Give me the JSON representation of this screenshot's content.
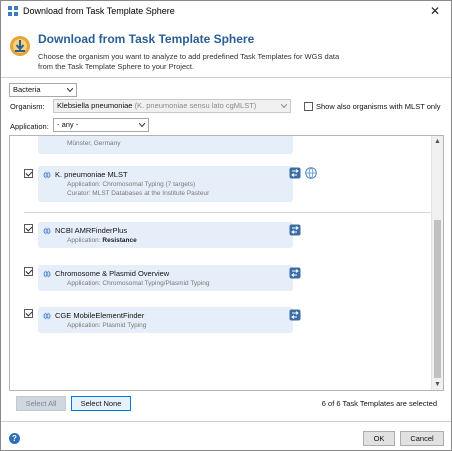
{
  "window": {
    "title": "Download from Task Template Sphere",
    "close_glyph": "✕"
  },
  "header": {
    "title": "Download from Task Template Sphere",
    "description_line1": "Choose the organism you want to analyze to add predefined Task Templates for WGS data",
    "description_line2": "from the Task Template Sphere to your Project."
  },
  "filters": {
    "domain_value": "Bacteria",
    "organism_label": "Organism:",
    "organism_value": "Klebsiella pneumoniae",
    "organism_extra": "(K. pneumoniae sensu lato cgMLST)",
    "show_mlst_label": "Show also organisms with MLST only",
    "show_mlst_checked": false,
    "application_label": "Application:",
    "application_value": "- any -"
  },
  "templates": [
    {
      "name": "",
      "sub1": "Münster, Germany",
      "sub2": "",
      "checked": true
    },
    {
      "name": "K. pneumoniae MLST",
      "sub1": "Application: Chromosomal Typing (7 targets)",
      "sub2": "Curator: MLST Databases at the Institute Pasteur",
      "checked": true
    },
    {
      "name": "NCBI AMRFinderPlus",
      "sub1_prefix": "Application:",
      "sub1_bold": "Resistance",
      "checked": true
    },
    {
      "name": "Chromosome & Plasmid Overview",
      "sub1": "Application: Chromosomal Typing/Plasmid Typing",
      "checked": true
    },
    {
      "name": "CGE MobileElementFinder",
      "sub1": "Application: Plasmid Typing",
      "checked": true
    }
  ],
  "footer": {
    "select_all": "Select All",
    "select_none": "Select None",
    "status": "6 of 6 Task Templates are selected",
    "ok": "OK",
    "cancel": "Cancel",
    "help_glyph": "?"
  },
  "colors": {
    "accent": "#2a5f95",
    "item_bg": "#e6eff9",
    "focus": "#0078d7"
  }
}
